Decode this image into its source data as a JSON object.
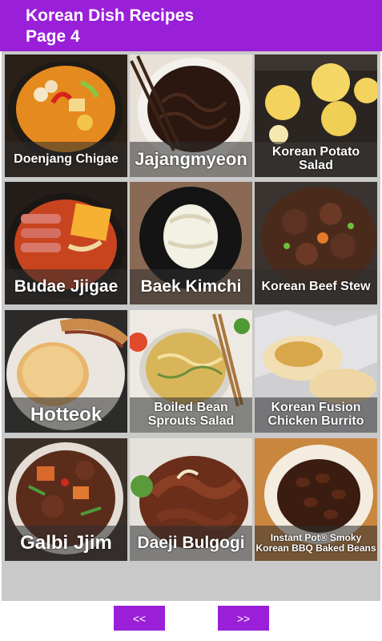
{
  "header": {
    "title_line1": "Korean Dish Recipes",
    "title_line2": "Page 4"
  },
  "recipes": [
    {
      "label": "Doenjang Chigae",
      "icon": "stew-photo"
    },
    {
      "label": "Jajangmyeon",
      "icon": "noodle-photo"
    },
    {
      "label": "Korean Potato Salad",
      "icon": "potato-salad-photo"
    },
    {
      "label": "Budae Jjigae",
      "icon": "army-stew-photo"
    },
    {
      "label": "Baek Kimchi",
      "icon": "white-kimchi-photo"
    },
    {
      "label": "Korean Beef Stew",
      "icon": "beef-stew-photo"
    },
    {
      "label": "Hotteok",
      "icon": "pancake-photo"
    },
    {
      "label": "Boiled Bean Sprouts Salad",
      "icon": "sprouts-salad-photo"
    },
    {
      "label": "Korean Fusion Chicken Burrito",
      "icon": "burrito-photo"
    },
    {
      "label": "Galbi Jjim",
      "icon": "braised-ribs-photo"
    },
    {
      "label": "Daeji Bulgogi",
      "icon": "pork-bulgogi-photo"
    },
    {
      "label": "Instant Pot® Smoky Korean BBQ Baked Beans",
      "icon": "baked-beans-photo"
    }
  ],
  "nav": {
    "prev_label": "<<",
    "next_label": ">>"
  },
  "colors": {
    "accent": "#9a1fd8",
    "background": "#c9c9c9"
  }
}
